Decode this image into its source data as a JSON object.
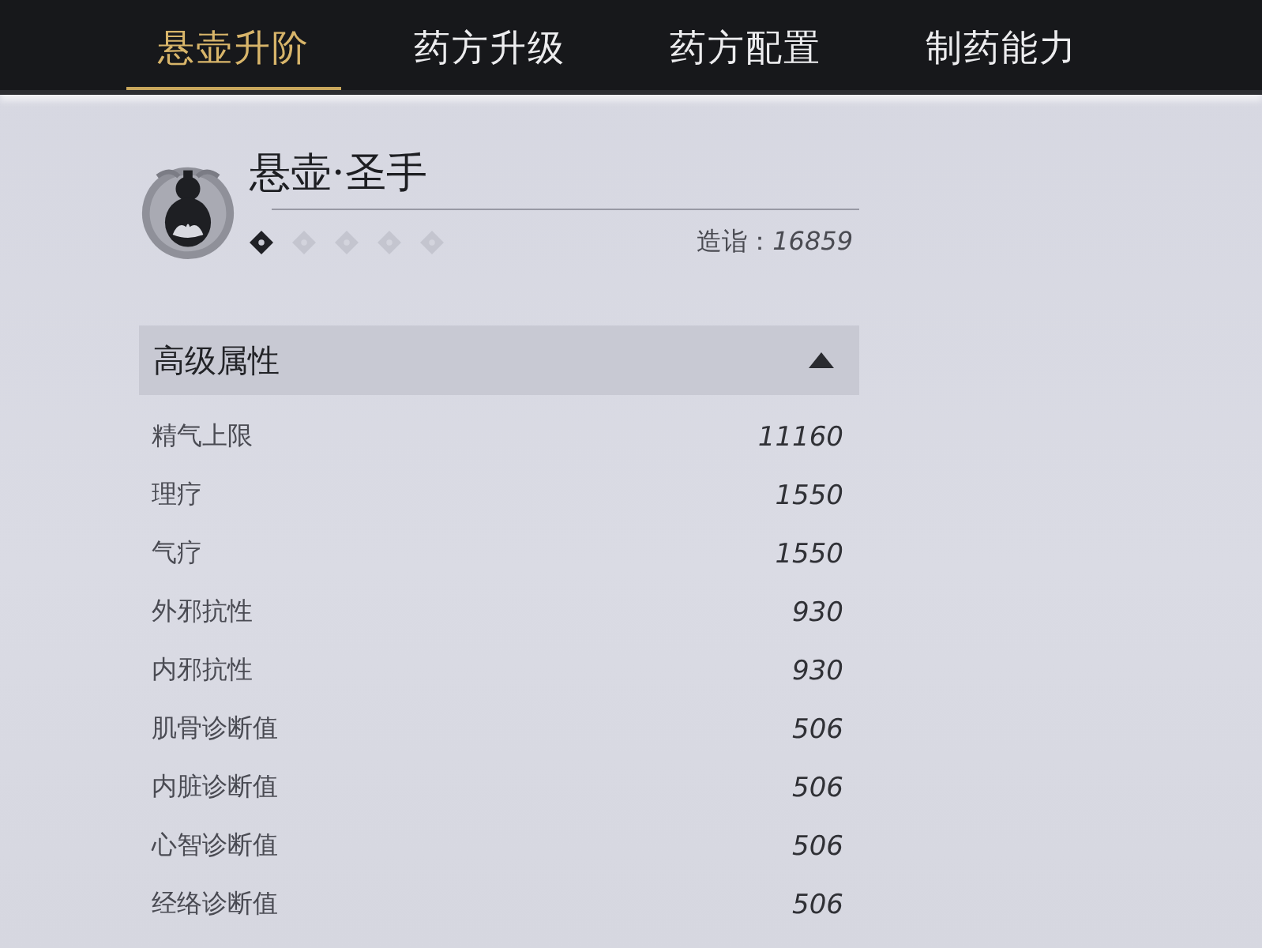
{
  "tabs": [
    {
      "label": "悬壶升阶",
      "selected": true
    },
    {
      "label": "药方升级",
      "selected": false
    },
    {
      "label": "药方配置",
      "selected": false
    },
    {
      "label": "制药能力",
      "selected": false
    }
  ],
  "profile": {
    "title": "悬壶·圣手",
    "rank_pips": [
      {
        "filled": true
      },
      {
        "filled": false
      },
      {
        "filled": false
      },
      {
        "filled": false
      },
      {
        "filled": false
      }
    ],
    "mastery_label": "造诣：",
    "mastery_value": "16859"
  },
  "section": {
    "title": "高级属性",
    "expanded": true,
    "rows": [
      {
        "label": "精气上限",
        "value": "11160"
      },
      {
        "label": "理疗",
        "value": "1550"
      },
      {
        "label": "气疗",
        "value": "1550"
      },
      {
        "label": "外邪抗性",
        "value": "930"
      },
      {
        "label": "内邪抗性",
        "value": "930"
      },
      {
        "label": "肌骨诊断值",
        "value": "506"
      },
      {
        "label": "内脏诊断值",
        "value": "506"
      },
      {
        "label": "心智诊断值",
        "value": "506"
      },
      {
        "label": "经络诊断值",
        "value": "506"
      }
    ]
  }
}
